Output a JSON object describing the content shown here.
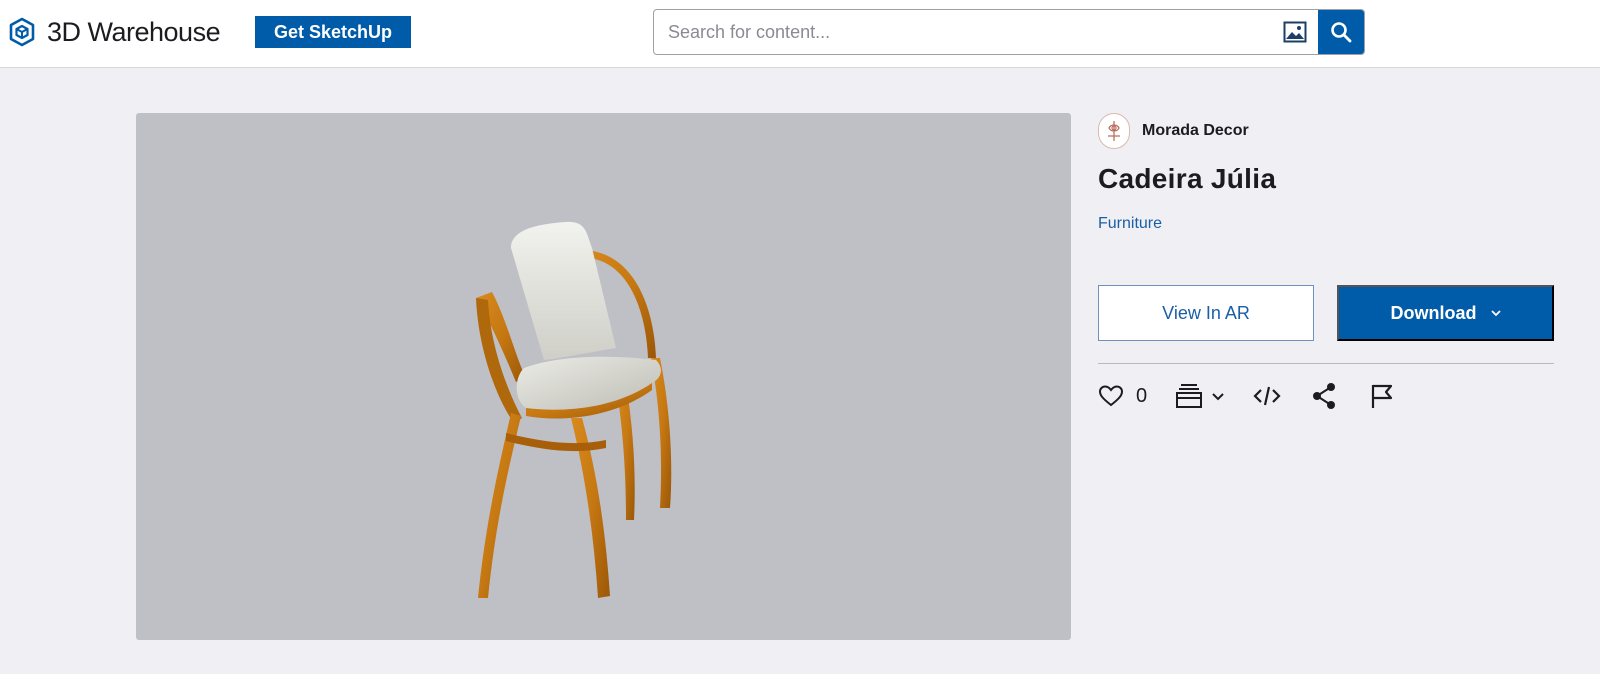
{
  "header": {
    "logo_text": "3D Warehouse",
    "get_sketchup": "Get SketchUp",
    "search_placeholder": "Search for content..."
  },
  "model": {
    "author": "Morada Decor",
    "title": "Cadeira Júlia",
    "category": "Furniture",
    "like_count": "0"
  },
  "actions": {
    "view_ar": "View In AR",
    "download": "Download"
  },
  "icons": {
    "logo": "cube-logo-icon",
    "image_search": "image-search-icon",
    "search": "search-icon",
    "like": "heart-icon",
    "collection": "collection-stack-icon",
    "embed": "code-icon",
    "share": "share-icon",
    "report": "flag-icon"
  },
  "colors": {
    "brand_blue": "#005ba8",
    "link_blue": "#1a5fa6",
    "viewer_bg": "#bfc0c5",
    "page_bg": "#f0f0f4"
  }
}
